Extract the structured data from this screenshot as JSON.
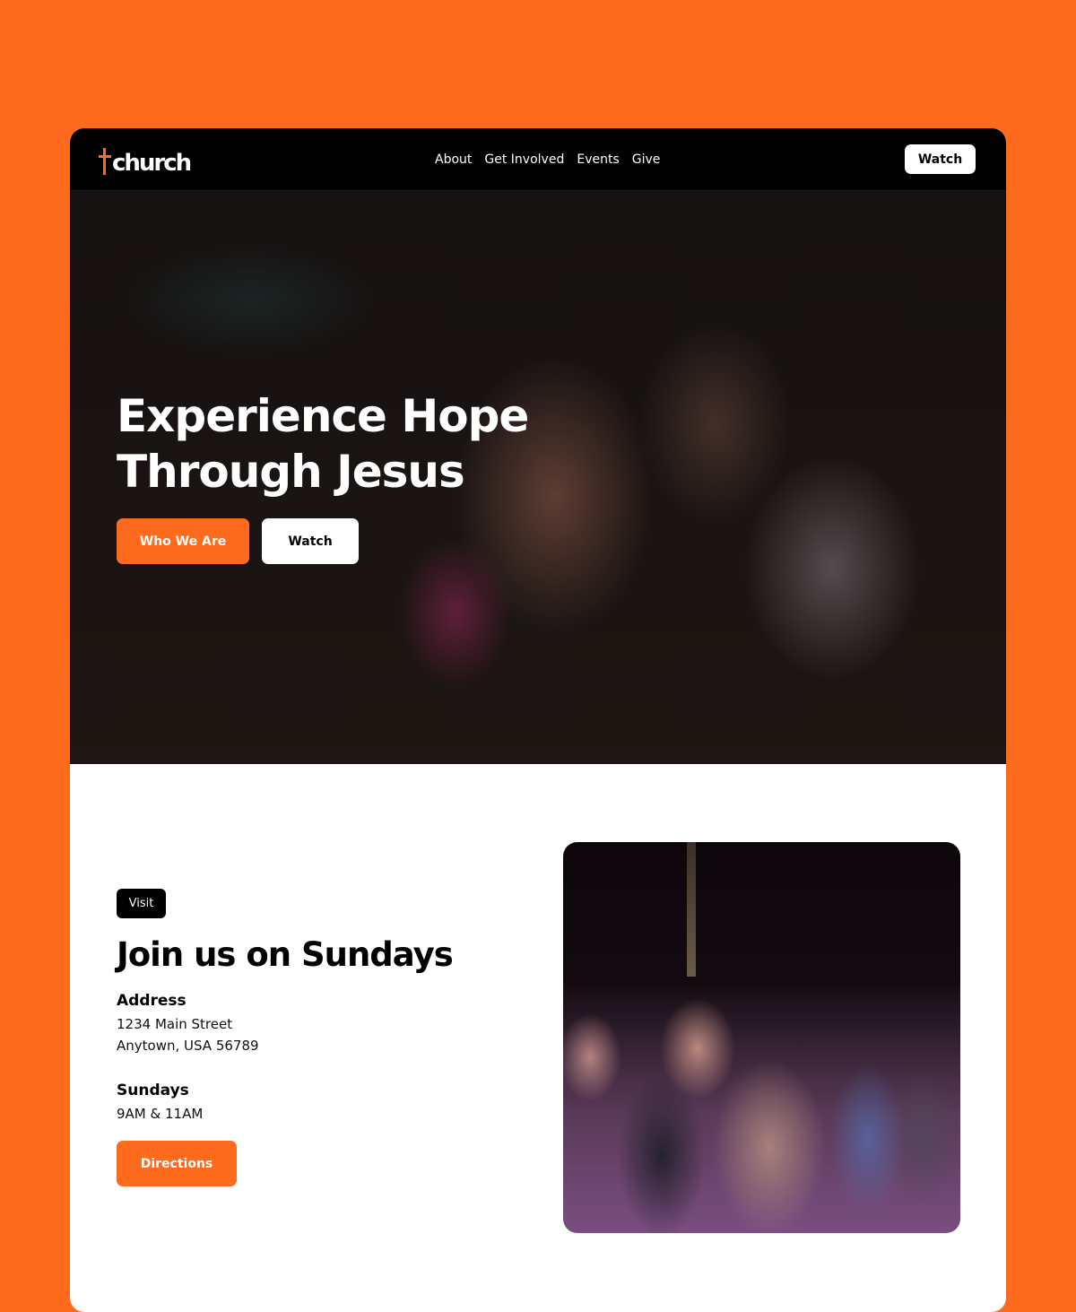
{
  "nav": {
    "logo_text": "church",
    "links": [
      "About",
      "Get Involved",
      "Events",
      "Give"
    ],
    "watch_label": "Watch"
  },
  "hero": {
    "title": "Experience Hope Through Jesus",
    "primary_button": "Who We Are",
    "secondary_button": "Watch",
    "image_description": "Worshippers singing with raised hands in a dimly lit church"
  },
  "visit": {
    "badge": "Visit",
    "title": "Join us on Sundays",
    "address_label": "Address",
    "address_line1": "1234 Main Street",
    "address_line2": "Anytown, USA 56789",
    "schedule_label": "Sundays",
    "schedule_times": "9AM & 11AM",
    "directions_label": "Directions",
    "image_description": "Congregation worshipping with hands raised under purple stage lights"
  },
  "colors": {
    "brand": "#fe6b1f",
    "nav_bg": "#000000",
    "card_bg": "#ffffff"
  }
}
